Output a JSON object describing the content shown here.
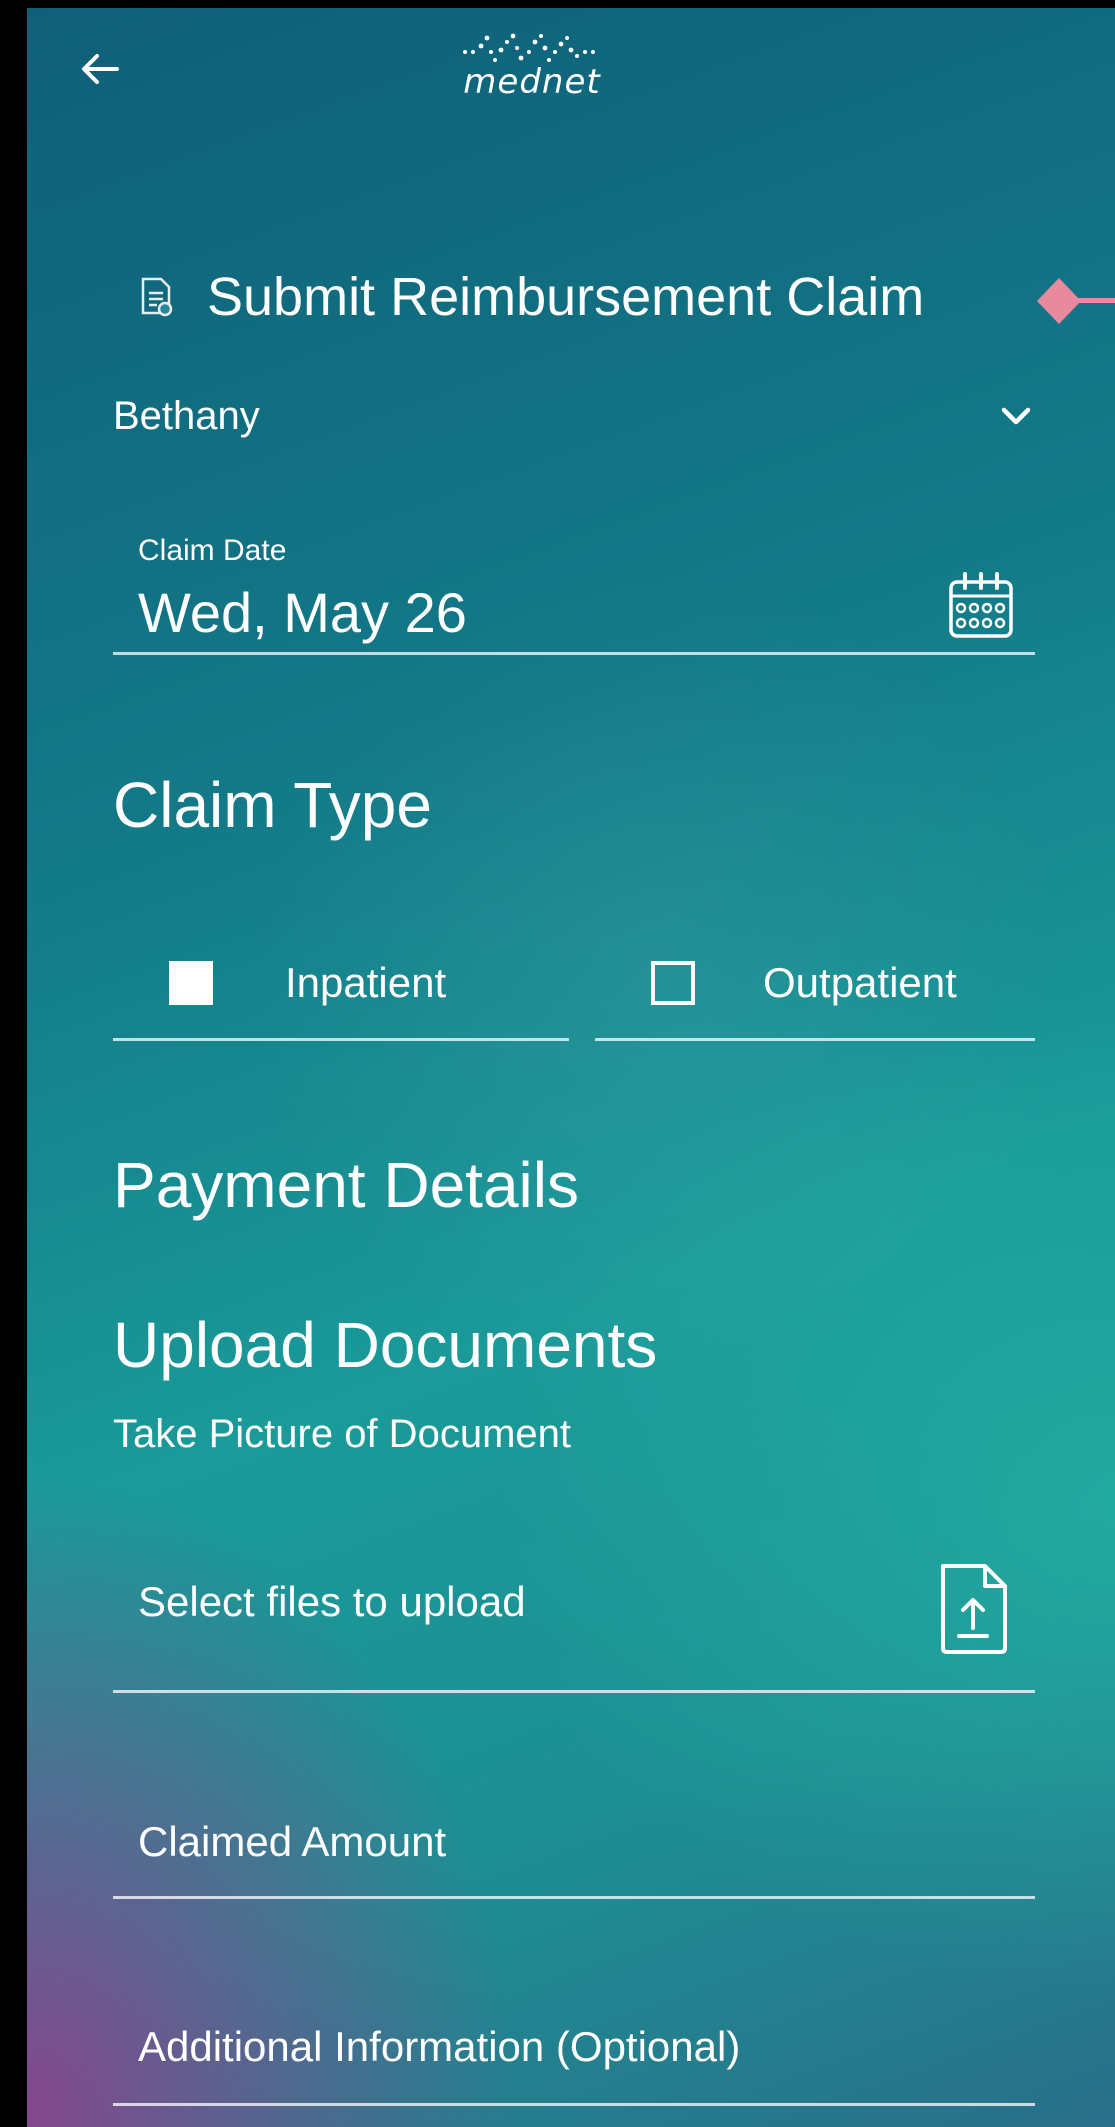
{
  "header": {
    "logo_text": "mednet",
    "back_icon": "arrow-left-icon"
  },
  "page": {
    "title": "Submit Reimbursement Claim",
    "title_icon": "document-icon"
  },
  "member_select": {
    "selected": "Bethany",
    "icon": "chevron-down-icon"
  },
  "claim_date": {
    "label": "Claim Date",
    "value": "Wed, May 26",
    "icon": "calendar-icon"
  },
  "claim_type": {
    "heading": "Claim Type",
    "options": [
      {
        "label": "Inpatient",
        "checked": true
      },
      {
        "label": "Outpatient",
        "checked": false
      }
    ]
  },
  "payment": {
    "heading": "Payment Details"
  },
  "upload": {
    "heading": "Upload Documents",
    "take_picture": "Take Picture of Document",
    "select_files_placeholder": "Select files to upload",
    "icon": "file-upload-icon"
  },
  "claimed_amount": {
    "placeholder": "Claimed Amount"
  },
  "additional_info": {
    "placeholder": "Additional Information (Optional)"
  },
  "colors": {
    "text": "#ffffff",
    "marker": "#e8899e",
    "bg_top": "#0f5f78",
    "bg_mid": "#1a9a99",
    "bg_purple": "#963c8c"
  }
}
